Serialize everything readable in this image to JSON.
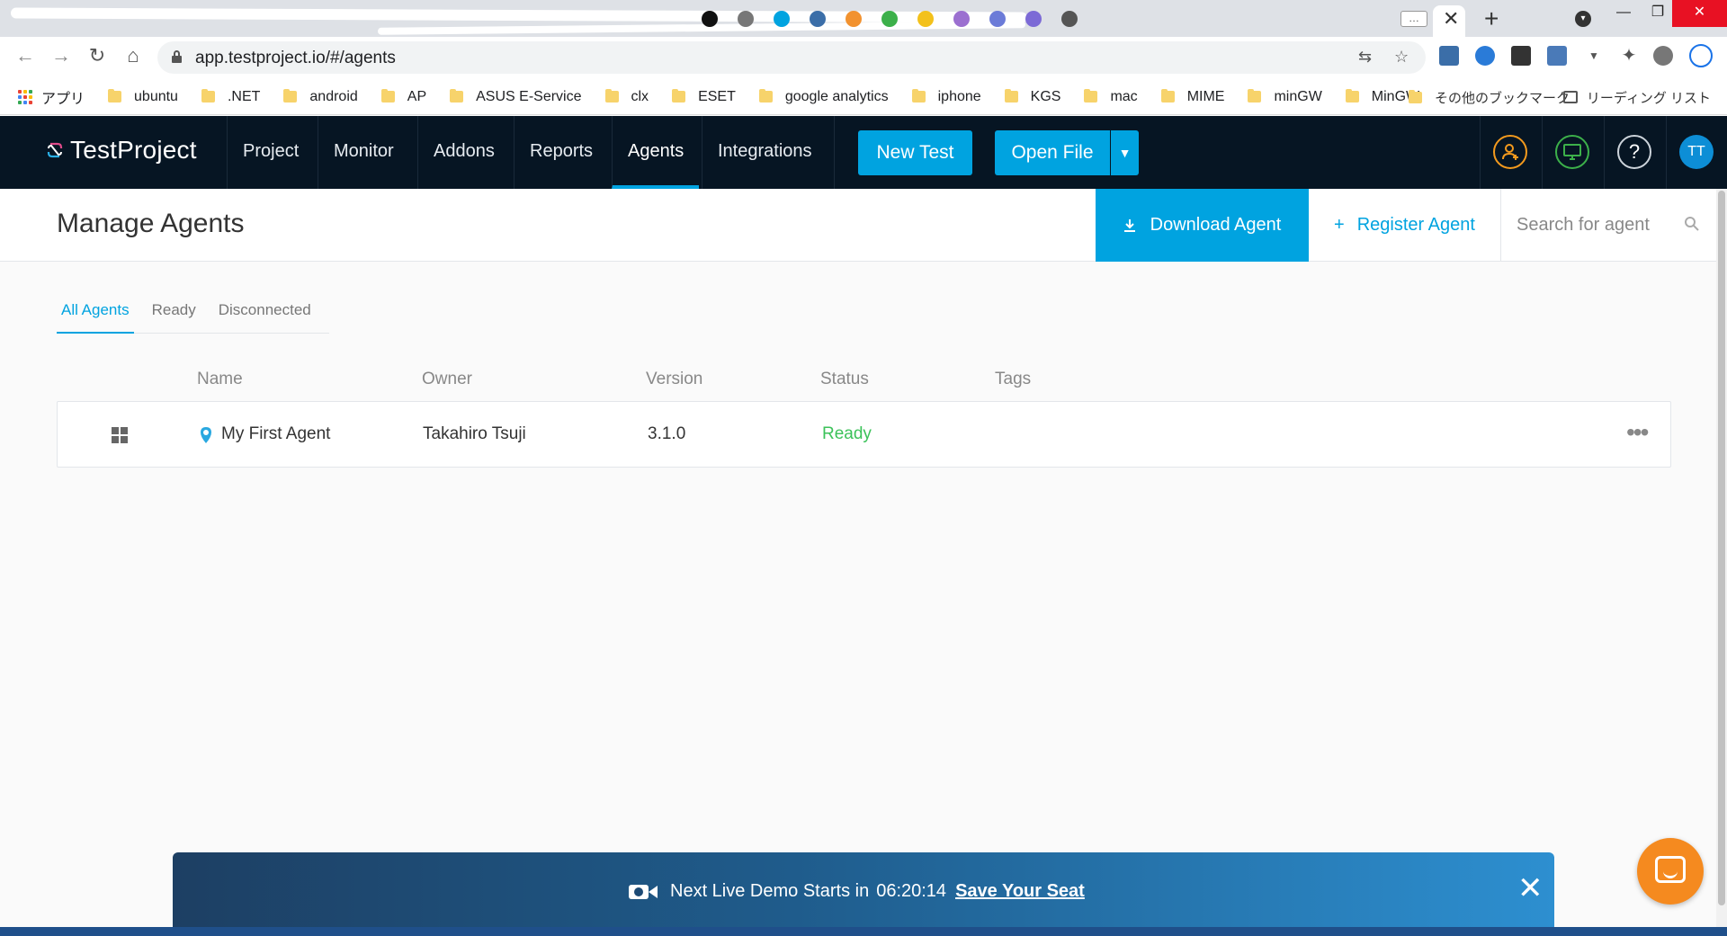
{
  "browser": {
    "url": "app.testproject.io/#/agents",
    "bookmarks": [
      {
        "label": "ubuntu"
      },
      {
        "label": ".NET"
      },
      {
        "label": "android"
      },
      {
        "label": "AP"
      },
      {
        "label": "ASUS E-Service"
      },
      {
        "label": "clx"
      },
      {
        "label": "ESET"
      },
      {
        "label": "google analytics"
      },
      {
        "label": "iphone"
      },
      {
        "label": "KGS"
      },
      {
        "label": "mac"
      },
      {
        "label": "MIME"
      },
      {
        "label": "minGW"
      },
      {
        "label": "MinGW"
      }
    ],
    "apps_label": "アプリ",
    "more_bookmarks": "»",
    "other_bookmarks": "その他のブックマーク",
    "reading_list": "リーディング リスト"
  },
  "header": {
    "logo_text": "TestProject",
    "nav": [
      {
        "label": "Project"
      },
      {
        "label": "Monitor"
      },
      {
        "label": "Addons"
      },
      {
        "label": "Reports"
      },
      {
        "label": "Agents"
      },
      {
        "label": "Integrations"
      }
    ],
    "active_nav": "Agents",
    "new_test_label": "New Test",
    "open_file_label": "Open File",
    "avatar_initials": "TT",
    "accent_color": "#00a3e0",
    "header_bg": "#061523"
  },
  "page": {
    "title": "Manage Agents",
    "download_label": "Download Agent",
    "register_label": "Register Agent",
    "search_placeholder": "Search for agent"
  },
  "filters": [
    {
      "label": "All Agents",
      "active": true
    },
    {
      "label": "Ready",
      "active": false
    },
    {
      "label": "Disconnected",
      "active": false
    }
  ],
  "table": {
    "columns": [
      "Name",
      "Owner",
      "Version",
      "Status",
      "Tags"
    ],
    "rows": [
      {
        "os_icon": "windows-icon",
        "name": "My First Agent",
        "owner": "Takahiro Tsuji",
        "version": "3.1.0",
        "status": "Ready",
        "tags": ""
      }
    ]
  },
  "banner": {
    "text": "Next Live Demo Starts in",
    "timer": "06:20:14",
    "cta": "Save Your Seat"
  },
  "colors": {
    "status_ready": "#3cc25a",
    "chat_button": "#f58a1f"
  }
}
